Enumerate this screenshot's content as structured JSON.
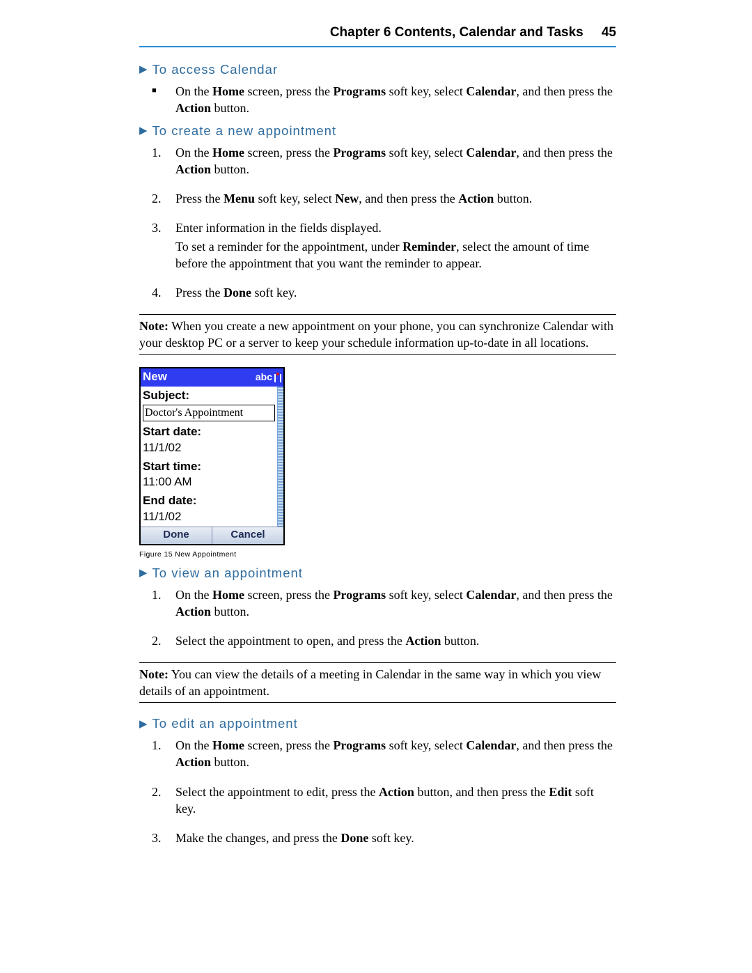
{
  "header": {
    "chapter": "Chapter 6 Contents, Calendar and Tasks",
    "page_number": "45"
  },
  "sections": {
    "access": {
      "title": "To access Calendar",
      "bullet": {
        "pre": "On the ",
        "b1": "Home",
        "mid1": " screen, press the ",
        "b2": "Programs",
        "mid2": " soft key, select ",
        "b3": "Calendar",
        "mid3": ", and then press the ",
        "b4": "Action",
        "post": " button."
      }
    },
    "create": {
      "title": "To create a new appointment",
      "step1": {
        "pre": "On the ",
        "b1": "Home",
        "mid1": " screen, press the ",
        "b2": "Programs",
        "mid2": " soft key, select ",
        "b3": "Calendar",
        "mid3": ", and then press the ",
        "b4": "Action",
        "post": " button."
      },
      "step2": {
        "pre": "Press the ",
        "b1": "Menu",
        "mid1": " soft key, select ",
        "b2": "New",
        "mid2": ", and then press the ",
        "b3": "Action",
        "post": " button."
      },
      "step3_line1": "Enter information in the fields displayed.",
      "step3_line2_pre": "To set a reminder for the appointment, under ",
      "step3_line2_b": "Reminder",
      "step3_line2_post": ", select the amount of time before the appointment that you want the reminder to appear.",
      "step4_pre": "Press the ",
      "step4_b": "Done",
      "step4_post": " soft key.",
      "note_label": "Note:",
      "note_text": " When you create a new appointment on your phone, you can synchronize Calendar with your desktop PC or a server to keep your schedule information up-to-date in all locations."
    },
    "view": {
      "title": "To view an appointment",
      "step1": {
        "pre": "On the ",
        "b1": "Home",
        "mid1": " screen, press the ",
        "b2": "Programs",
        "mid2": " soft key, select ",
        "b3": "Calendar",
        "mid3": ", and then press the ",
        "b4": "Action",
        "post": " button."
      },
      "step2_pre": "Select the appointment to open, and press the ",
      "step2_b": "Action",
      "step2_post": " button.",
      "note_label": "Note:",
      "note_text": " You can view the details of a meeting in Calendar in the same way in which you view details of an appointment."
    },
    "edit": {
      "title": "To edit an appointment",
      "step1": {
        "pre": "On the ",
        "b1": "Home",
        "mid1": " screen, press the ",
        "b2": "Programs",
        "mid2": " soft key, select ",
        "b3": "Calendar",
        "mid3": ", and then press the ",
        "b4": "Action",
        "post": " button."
      },
      "step2_pre": "Select the appointment to edit, press the ",
      "step2_b1": "Action",
      "step2_mid": " button, and then press the ",
      "step2_b2": "Edit",
      "step2_post": " soft key.",
      "step3_pre": "Make the changes, and press the ",
      "step3_b": "Done",
      "step3_post": " soft key."
    }
  },
  "figure": {
    "caption": "Figure 15 New Appointment",
    "phone": {
      "title": "New",
      "status": "abc",
      "labels": {
        "subject": "Subject:",
        "start_date": "Start date:",
        "start_time": "Start time:",
        "end_date": "End date:"
      },
      "values": {
        "subject": "Doctor's Appointment",
        "start_date": "11/1/02",
        "start_time": "11:00 AM",
        "end_date": "11/1/02"
      },
      "softkeys": {
        "left": "Done",
        "right": "Cancel"
      }
    }
  },
  "markers": {
    "n1": "1.",
    "n2": "2.",
    "n3": "3.",
    "n4": "4."
  }
}
